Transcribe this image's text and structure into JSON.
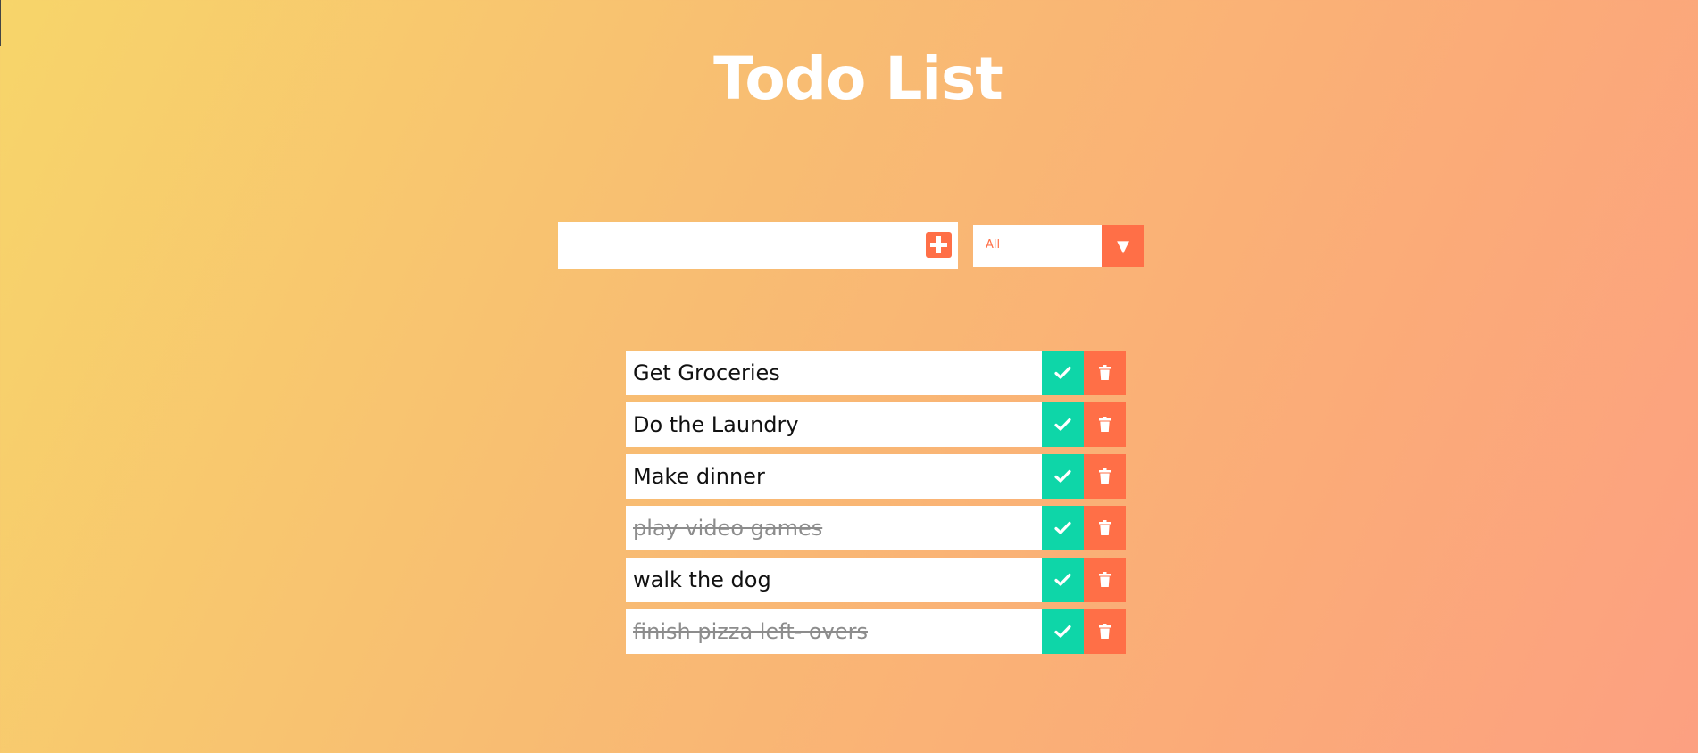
{
  "header": {
    "title": "Todo List"
  },
  "add_form": {
    "input_value": "",
    "input_placeholder": "",
    "add_icon": "plus-square-icon"
  },
  "filter": {
    "selected": "All",
    "arrow_icon": "caret-down-icon",
    "arrow_glyph": "▼"
  },
  "todos": [
    {
      "text": "Get Groceries",
      "completed": false
    },
    {
      "text": "Do the Laundry",
      "completed": false
    },
    {
      "text": "Make dinner",
      "completed": false
    },
    {
      "text": "play video games",
      "completed": true
    },
    {
      "text": "walk the dog",
      "completed": false
    },
    {
      "text": "finish pizza left- overs",
      "completed": true
    }
  ],
  "icons": {
    "complete": "check-icon",
    "delete": "trash-icon"
  },
  "colors": {
    "accent": "#ff6f47",
    "complete_green": "#0ed6a8",
    "gradient_start": "#f7d56a",
    "gradient_end": "#fca081",
    "completed_text": "#8c8c8c"
  }
}
